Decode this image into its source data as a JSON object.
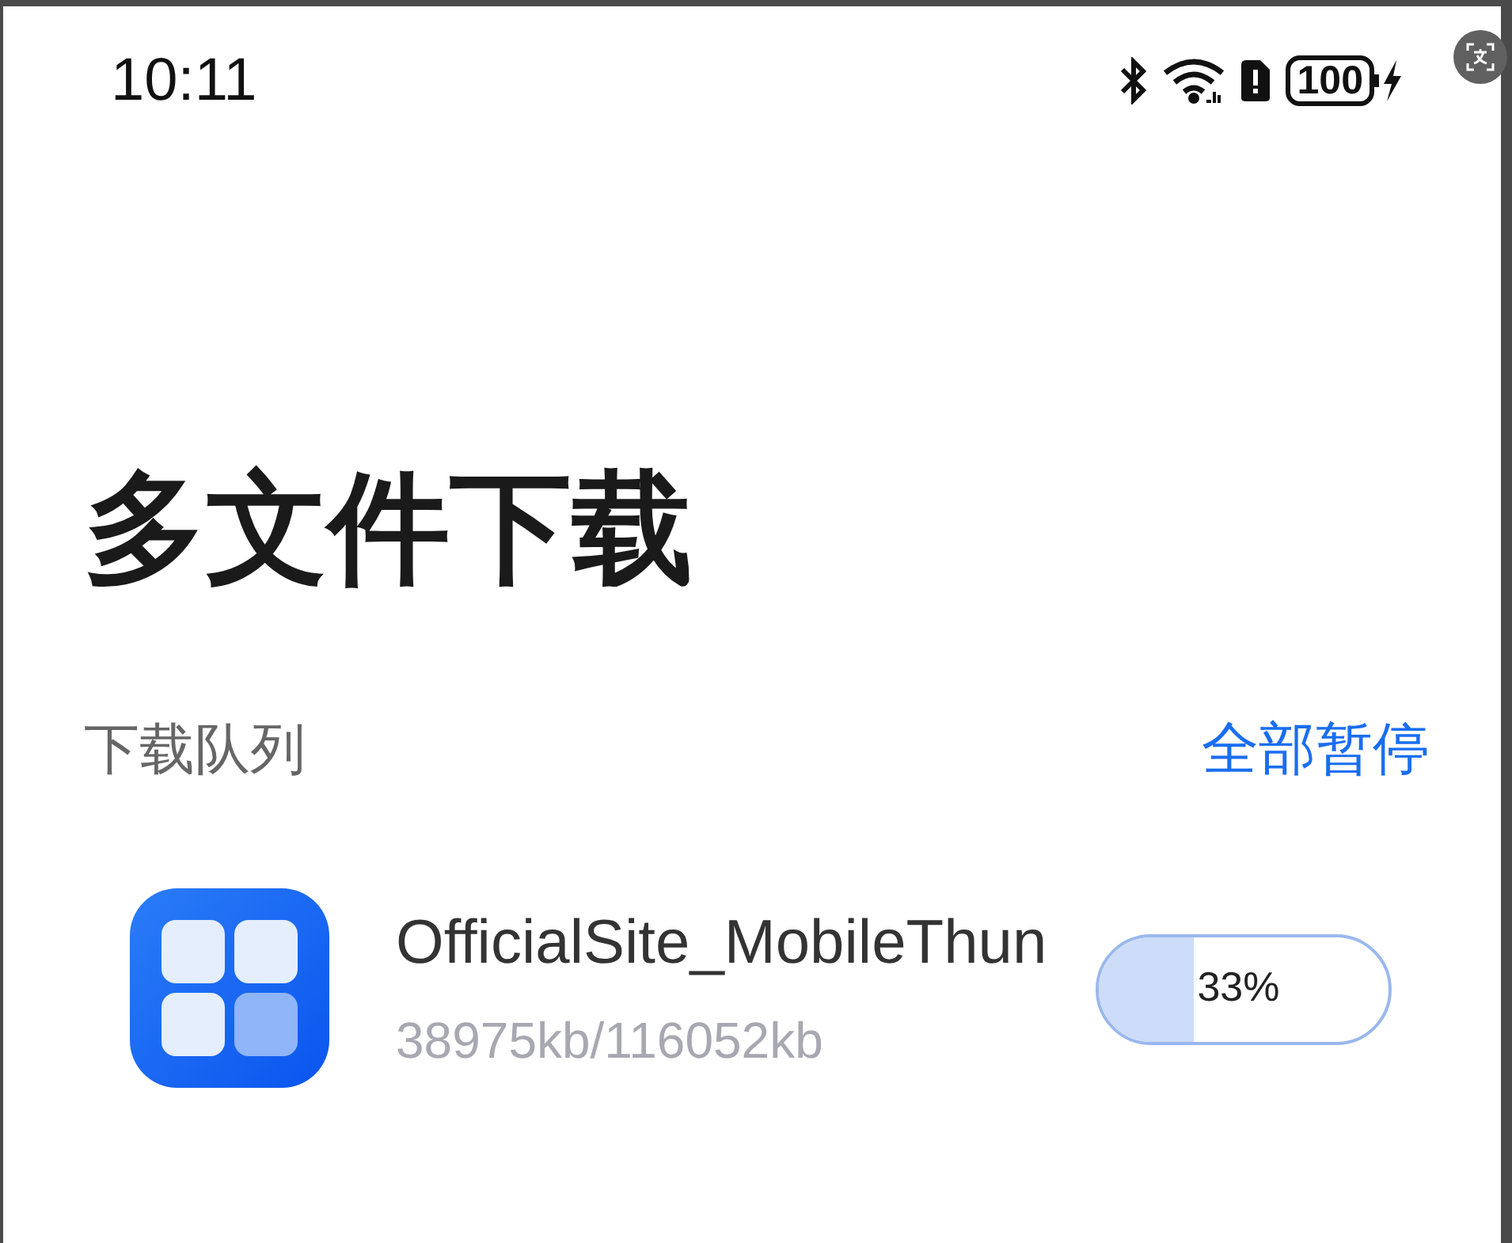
{
  "status_bar": {
    "time": "10:11",
    "battery": "100"
  },
  "title": "多文件下载",
  "section": {
    "label": "下载队列",
    "action": "全部暂停"
  },
  "downloads": [
    {
      "name": "OfficialSite_MobileThun",
      "size": "38975kb/116052kb",
      "level": 0.33,
      "percent": "33%"
    }
  ]
}
